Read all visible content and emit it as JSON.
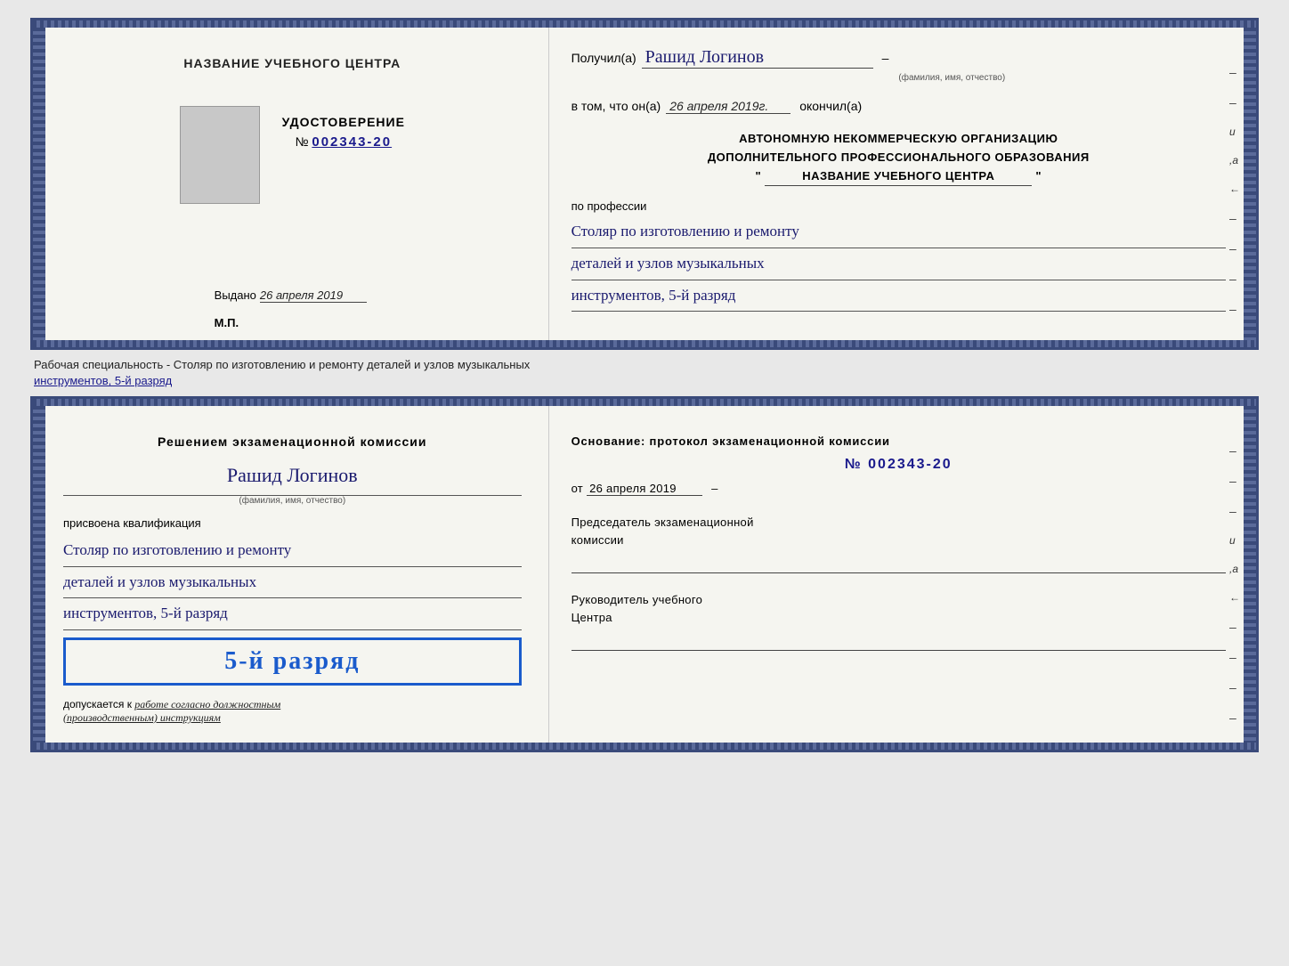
{
  "top_document": {
    "left_panel": {
      "center_title": "НАЗВАНИЕ УЧЕБНОГО ЦЕНТРА",
      "cert_label": "УДОСТОВЕРЕНИЕ",
      "cert_number_prefix": "№",
      "cert_number": "002343-20",
      "issued_label": "Выдано",
      "issued_date": "26 апреля 2019",
      "mp_label": "М.П."
    },
    "right_panel": {
      "received_label": "Получил(а)",
      "recipient_name": "Рашид Логинов",
      "fio_label": "(фамилия, имя, отчество)",
      "in_that_label": "в том, что он(а)",
      "date_value": "26 апреля 2019г.",
      "finished_label": "окончил(а)",
      "institution_line1": "АВТОНОМНУЮ НЕКОММЕРЧЕСКУЮ ОРГАНИЗАЦИЮ",
      "institution_line2": "ДОПОЛНИТЕЛЬНОГО ПРОФЕССИОНАЛЬНОГО ОБРАЗОВАНИЯ",
      "institution_quote_start": "\"",
      "institution_name": "НАЗВАНИЕ УЧЕБНОГО ЦЕНТРА",
      "institution_quote_end": "\"",
      "profession_label": "по профессии",
      "profession_line1": "Столяр по изготовлению и ремонту",
      "profession_line2": "деталей и узлов музыкальных",
      "profession_line3": "инструментов, 5-й разряд"
    }
  },
  "separator": {
    "text_plain": "Рабочая специальность - Столяр по изготовлению и ремонту деталей и узлов музыкальных",
    "text_underlined": "инструментов, 5-й разряд"
  },
  "bottom_document": {
    "left_panel": {
      "decision_title": "Решением экзаменационной комиссии",
      "person_name": "Рашид Логинов",
      "fio_label": "(фамилия, имя, отчество)",
      "qualification_label": "присвоена квалификация",
      "qualification_line1": "Столяр по изготовлению и ремонту",
      "qualification_line2": "деталей и узлов музыкальных",
      "qualification_line3": "инструментов, 5-й разряд",
      "rank_display": "5-й разряд",
      "admitted_label": "допускается к",
      "admitted_value": "работе согласно должностным",
      "admitted_value2": "(производственным) инструкциям"
    },
    "right_panel": {
      "basis_label": "Основание: протокол экзаменационной комиссии",
      "protocol_number": "№ 002343-20",
      "from_label": "от",
      "from_date": "26 апреля 2019",
      "chairman_title": "Председатель экзаменационной",
      "chairman_title2": "комиссии",
      "director_title": "Руководитель учебного",
      "director_title2": "Центра"
    }
  },
  "right_margin_marks": [
    "-",
    "-",
    "-",
    "и",
    ",а",
    "←",
    "-",
    "-",
    "-",
    "-",
    "-"
  ]
}
